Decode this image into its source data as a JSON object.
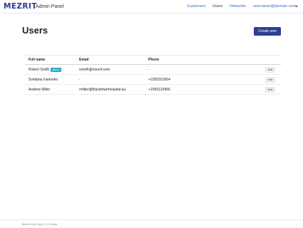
{
  "brand": {
    "logo": "MEZRIT",
    "title": "Admin Panel"
  },
  "nav": {
    "links": [
      "Customers",
      "Users",
      "Networks"
    ],
    "active": "Users",
    "user": "username@domain.com",
    "caret_icon": "chevron-down-icon"
  },
  "page": {
    "title": "Users",
    "create_button": "Create user"
  },
  "table": {
    "headers": [
      "Full name",
      "Email",
      "Phone"
    ],
    "rows": [
      {
        "name": "Robert Smith",
        "badge": "admin",
        "email": "rsmith@mezrit.com",
        "phone": "-",
        "action": "Edit"
      },
      {
        "name": "Svetlana Ivanenko",
        "badge": "",
        "email": "-",
        "phone": "+1555321654",
        "action": "Edit"
      },
      {
        "name": "Andrew Miller",
        "badge": "",
        "email": "rmiller@blacktownhospital.au",
        "phone": "+1555123456",
        "action": "Edit"
      }
    ]
  },
  "footer": {
    "text": "Mezrit Web App v1.0.0-beta"
  },
  "colors": {
    "brand": "#2d3a8c",
    "primary_button": "#2d3f8f",
    "link": "#2f6fd6",
    "badge": "#2aa8c4"
  }
}
